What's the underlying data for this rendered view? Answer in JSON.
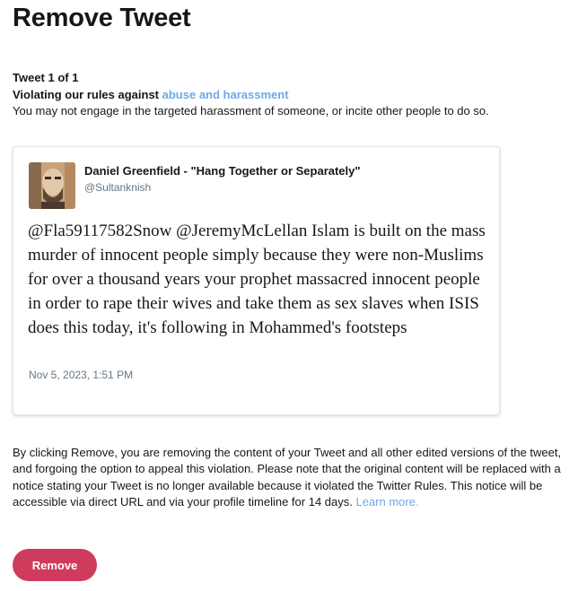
{
  "page": {
    "title": "Remove Tweet"
  },
  "violation": {
    "tweet_count": "Tweet 1 of 1",
    "prefix": "Violating our rules against ",
    "rule_link": "abuse and harassment",
    "description": "You may not engage in the targeted harassment of someone, or incite other people to do so."
  },
  "tweet": {
    "author_name": "Daniel Greenfield - \"Hang Together or Separately\"",
    "author_handle": "@Sultanknish",
    "text": "@Fla59117582Snow @JeremyMcLellan Islam is built on the mass murder of innocent people simply because they were non-Muslims for over a thousand years your prophet massacred innocent people in order to rape their wives and take them as sex slaves when ISIS does this today, it's following in Mohammed's footsteps",
    "timestamp": "Nov 5, 2023, 1:51 PM"
  },
  "notice": {
    "text": "By clicking Remove, you are removing the content of your Tweet and all other edited versions of the tweet, and forgoing the option to appeal this violation. Please note that the original content will be replaced with a notice stating your Tweet is no longer available because it violated the Twitter Rules. This notice will be accessible via direct URL and via your profile timeline for 14 days. ",
    "learn_more": "Learn more."
  },
  "actions": {
    "remove_label": "Remove"
  },
  "colors": {
    "link": "#6fa8e6",
    "remove_button": "#cf3b5c",
    "secondary_text": "#657786"
  }
}
